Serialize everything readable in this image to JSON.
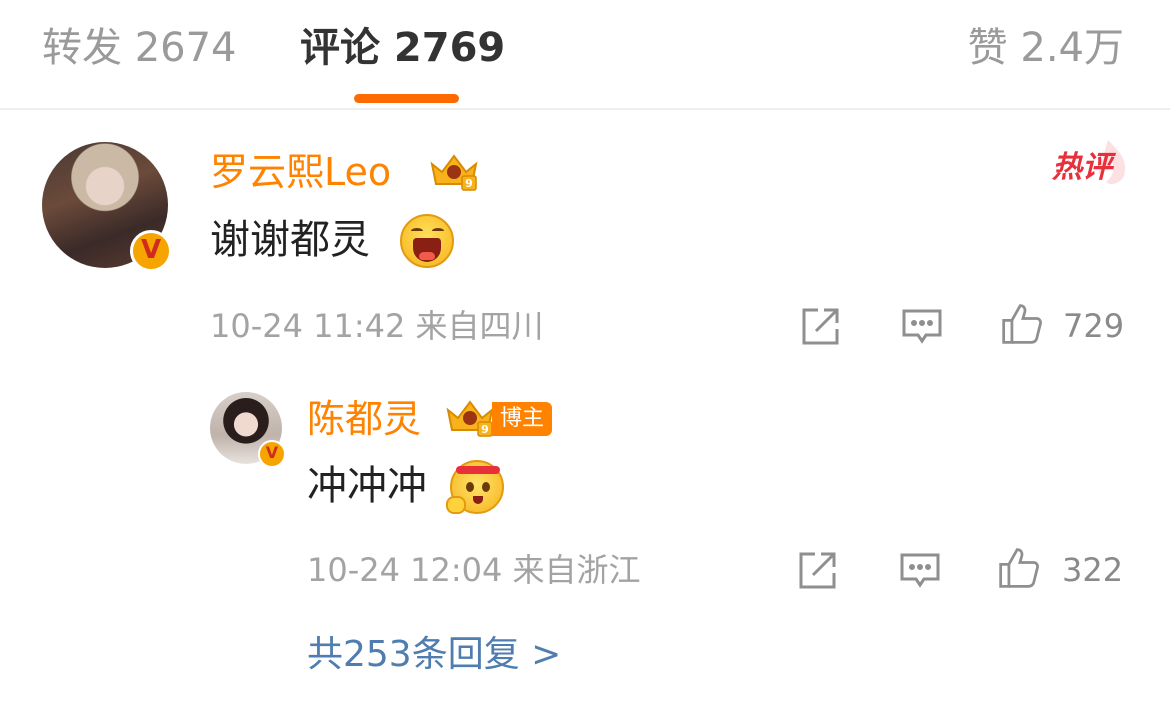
{
  "tabs": {
    "forward": "转发 2674",
    "comment": "评论 2769",
    "like": "赞 2.4万"
  },
  "comment": {
    "username": "罗云熙Leo",
    "hot_label": "热评",
    "text": "谢谢都灵",
    "emoji": "laughing-emoji",
    "meta": "10-24 11:42  来自四川",
    "like_count": "729"
  },
  "reply": {
    "username": "陈都灵",
    "role_tag": "博主",
    "text": "冲冲冲",
    "emoji": "cheer-emoji",
    "meta": "10-24 12:04  来自浙江",
    "like_count": "322"
  },
  "more_replies": "共253条回复 >",
  "colors": {
    "accent": "#ff6a00",
    "username": "#ff8200",
    "link": "#507daf",
    "hot": "#e8303a"
  }
}
